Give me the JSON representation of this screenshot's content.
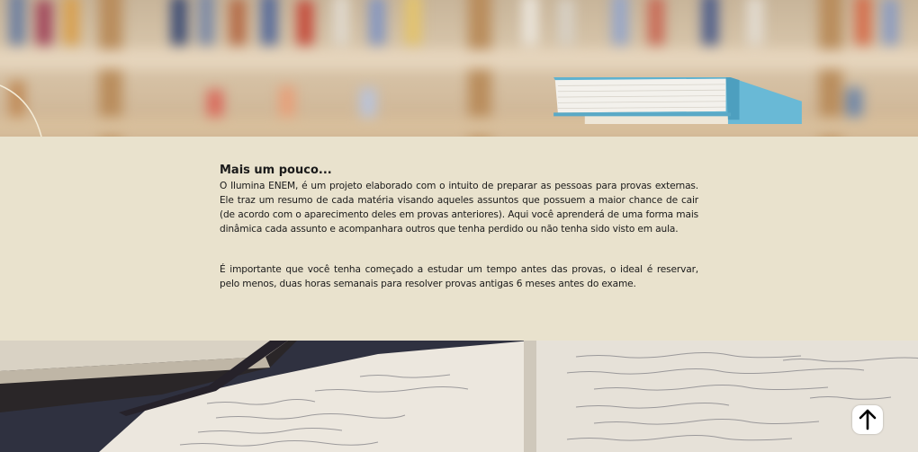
{
  "content": {
    "title": "Mais um pouco...",
    "paragraphs": [
      "O Ilumina ENEM, é um projeto elaborado com o intuito de preparar as pessoas para provas externas. Ele traz um resumo de cada matéria visando aqueles assuntos que possuem a maior chance de cair (de acordo com o aparecimento deles em provas anteriores). Aqui você aprenderá de uma forma mais dinâmica cada assunto e acompanhara outros que tenha perdido ou não tenha sido visto em aula.",
      "É importante que você tenha começado a estudar um tempo antes das provas, o ideal é reservar, pelo menos, duas horas semanais para resolver provas antigas 6 meses antes do exame."
    ]
  },
  "icons": {
    "back_to_top": "arrow-up-icon"
  },
  "colors": {
    "band_background": "#e9e2cd",
    "text": "#1a1a1a",
    "button_background": "#ffffff"
  }
}
